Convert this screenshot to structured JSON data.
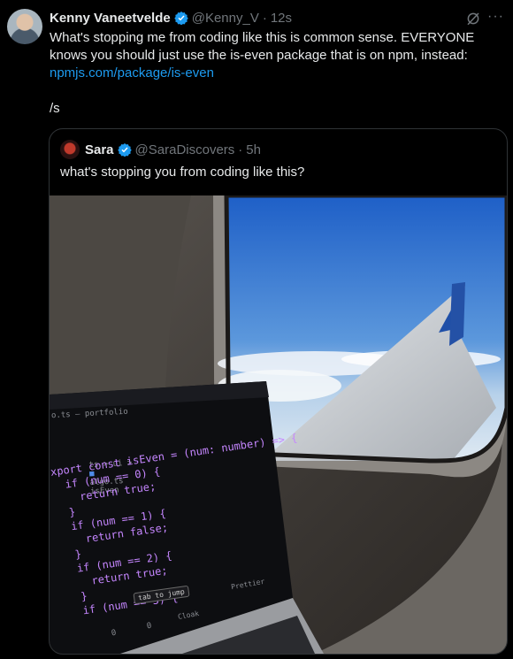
{
  "tweet": {
    "author_name": "Kenny Vaneetvelde",
    "author_handle": "@Kenny_V",
    "time": "12s",
    "line1": "What's stopping me from coding like this is common sense. EVERYONE knows you should just use the is-even package that is on npm, instead:",
    "link": "npmjs.com/package/is-even",
    "line_s": "/s",
    "icons": [
      "grok-icon",
      "more-icon",
      "verified-icon"
    ]
  },
  "quote": {
    "author_name": "Sara",
    "author_handle": "@SaraDiscovers",
    "time": "5h",
    "text": "what's stopping you from coding like this?"
  },
  "editor": {
    "window_title": "o.ts — portfolio",
    "breadcrumb_prefix": "ts > ui >",
    "breadcrumb_file": "algo.ts",
    "breadcrumb_symbol": "isEven",
    "tooltip": "tab to jump",
    "status_prettier": "Prettier",
    "status_cloak": "Cloak",
    "status_problems": "0",
    "status_ports": "0",
    "code_lines": [
      "xport const isEven = (num: number) => {",
      "  if (num == 0) {",
      "    return true;",
      "  }",
      "  if (num == 1) {",
      "    return false;",
      "  }",
      "  if (num == 2) {",
      "    return true;",
      "  }",
      "  if (num == 3) {"
    ]
  },
  "colors": {
    "accent_blue": "#1d9bf0",
    "muted": "#71767b",
    "text": "#e7e9ea",
    "border": "#2f3336",
    "keyword": "#c586ff",
    "number": "#ff6ba6",
    "identifier": "#82aaff"
  }
}
